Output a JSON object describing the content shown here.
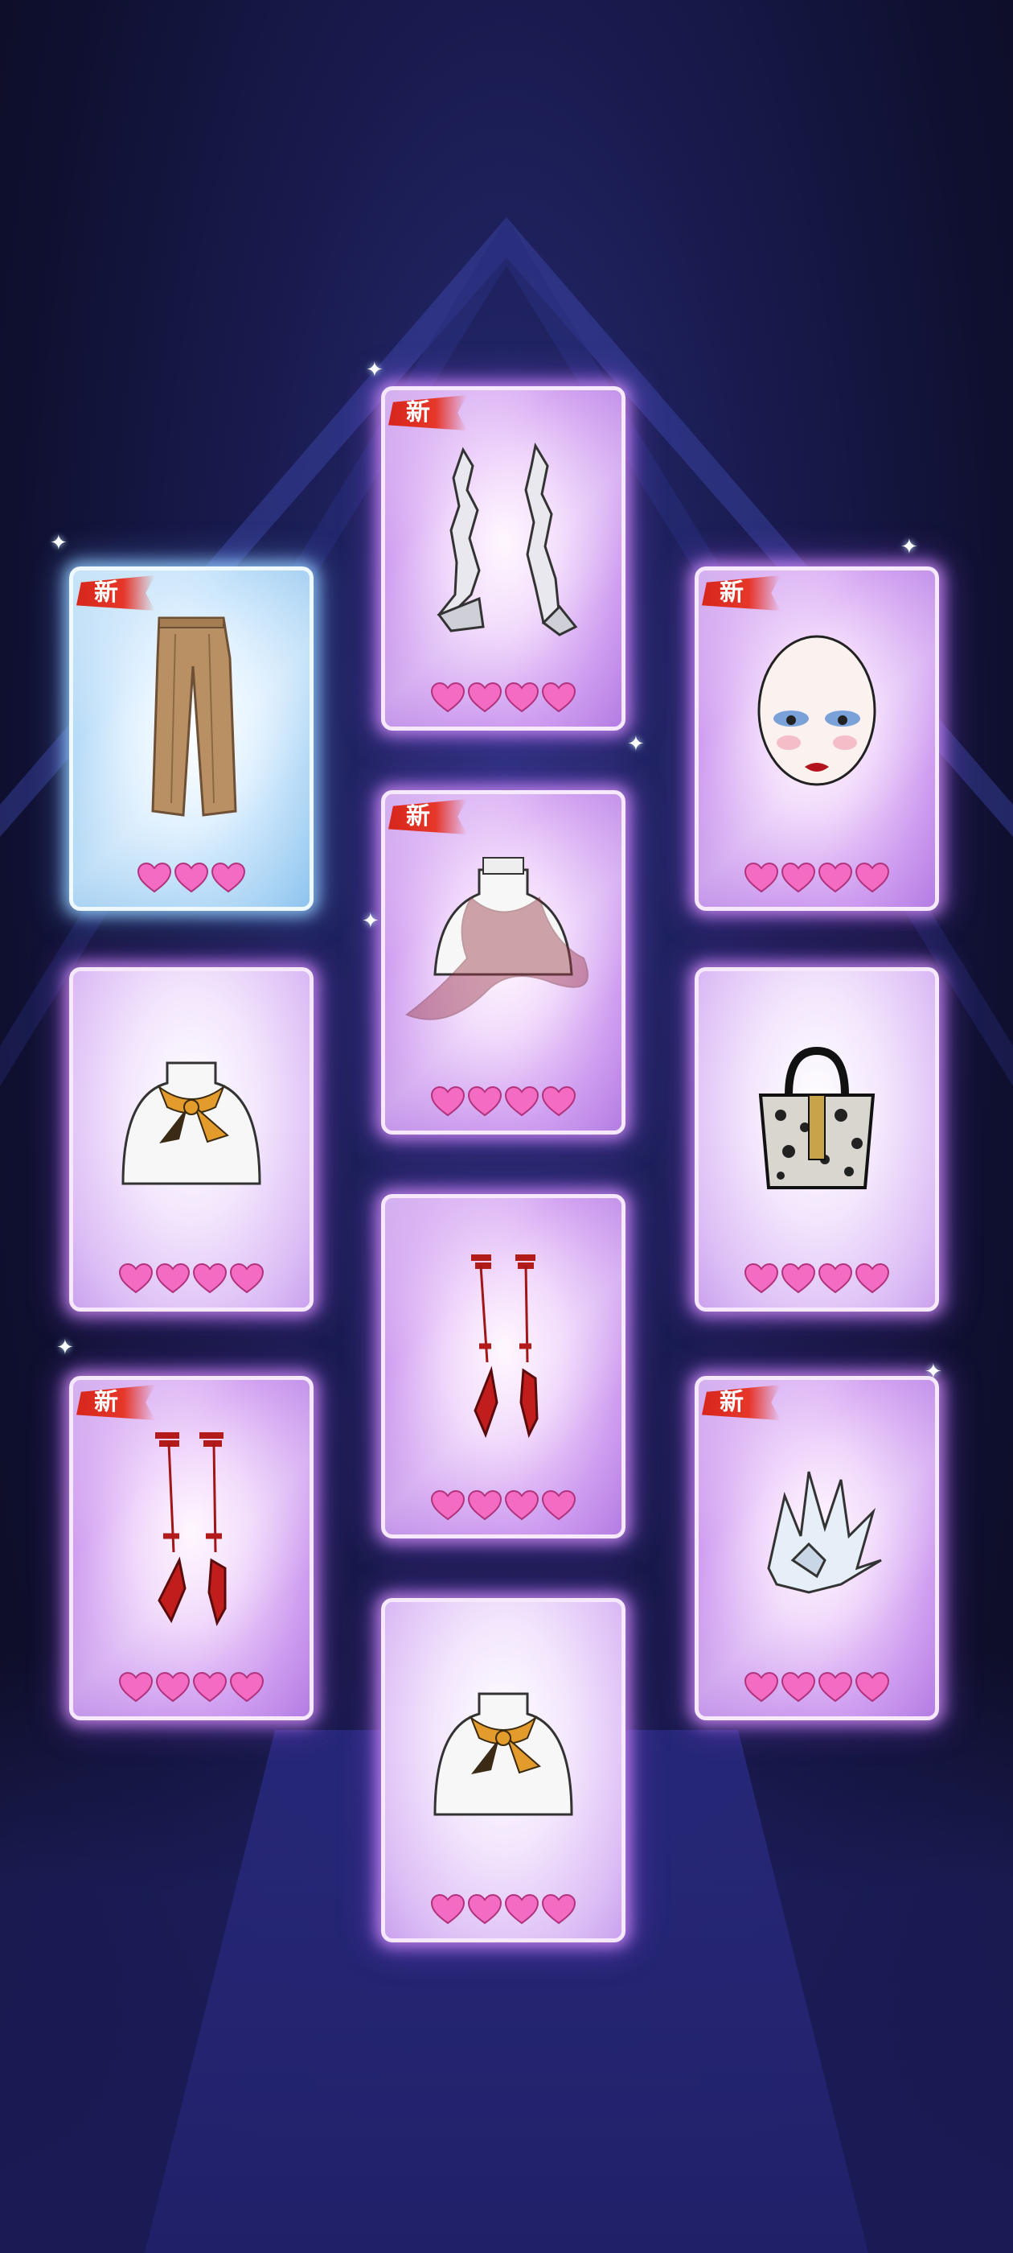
{
  "badge_text": "新",
  "colors": {
    "heart": "#f36bc2",
    "badge": "#d7261b"
  },
  "cards": [
    {
      "id": "pants",
      "item": "wide-leg-pants",
      "badge": true,
      "stars": 3,
      "style": "blue"
    },
    {
      "id": "crystal-heels",
      "item": "crystal-heels",
      "badge": true,
      "stars": 4,
      "style": "purple"
    },
    {
      "id": "makeup",
      "item": "makeup-face",
      "badge": true,
      "stars": 4,
      "style": "purple"
    },
    {
      "id": "sheer-scarf",
      "item": "sheer-scarf",
      "badge": true,
      "stars": 4,
      "style": "purple"
    },
    {
      "id": "silk-scarf-1",
      "item": "silk-scarf",
      "badge": false,
      "stars": 4,
      "style": "light"
    },
    {
      "id": "handbag",
      "item": "leopard-handbag",
      "badge": false,
      "stars": 4,
      "style": "light"
    },
    {
      "id": "red-heels-1",
      "item": "red-heels",
      "badge": false,
      "stars": 4,
      "style": "purple"
    },
    {
      "id": "red-heels-2",
      "item": "red-heels",
      "badge": true,
      "stars": 4,
      "style": "purple"
    },
    {
      "id": "crystal-headpiece",
      "item": "crystal-headpiece",
      "badge": true,
      "stars": 4,
      "style": "purple"
    },
    {
      "id": "silk-scarf-2",
      "item": "silk-scarf",
      "badge": false,
      "stars": 4,
      "style": "light"
    }
  ]
}
